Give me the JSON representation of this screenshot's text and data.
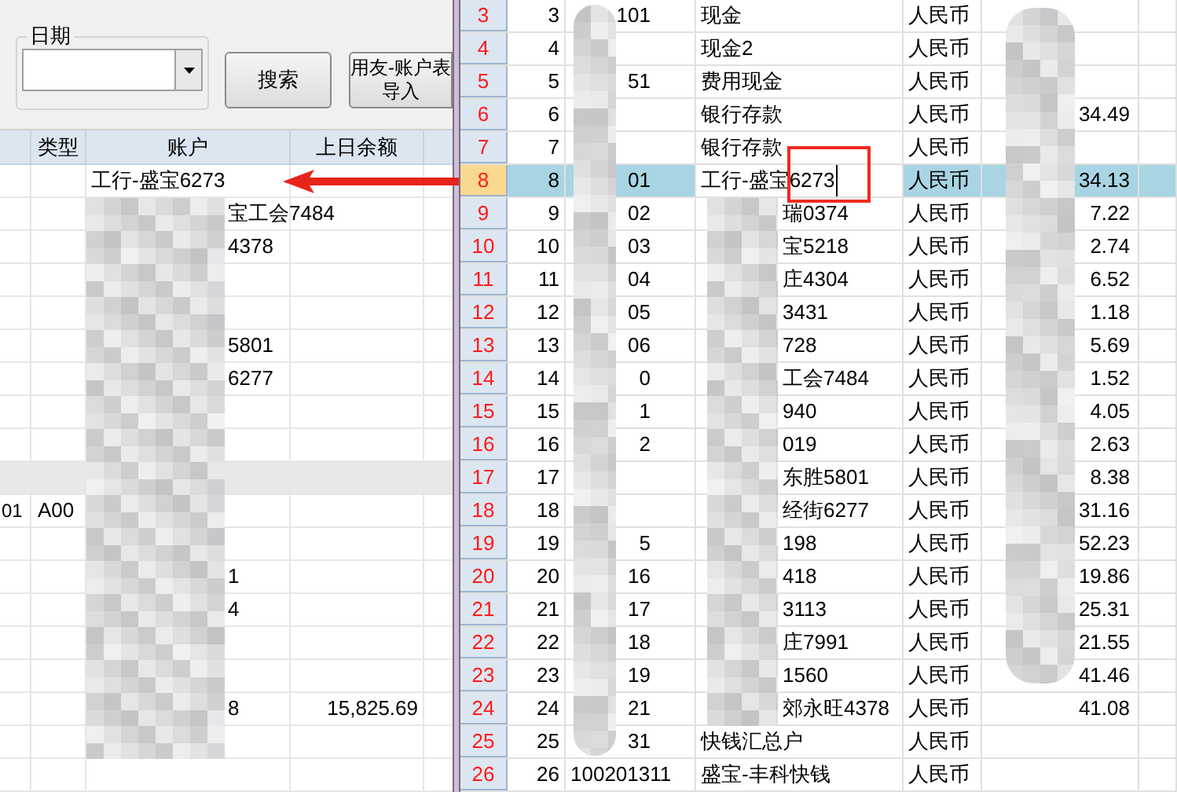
{
  "toolbar": {
    "date_group": {
      "label": "日期"
    },
    "buttons": [
      {
        "label": "搜索"
      },
      {
        "label": "用友-账户表导入"
      }
    ]
  },
  "left_table": {
    "columns": [
      {
        "label": "类型"
      },
      {
        "label": "账户"
      },
      {
        "label": "上日余额"
      }
    ],
    "rows": [
      {
        "account": "工行-盛宝6273",
        "masked": false,
        "selected": false
      },
      {
        "account": "宝工会7484",
        "masked": true,
        "selected": false
      },
      {
        "account": "4378",
        "masked": true,
        "selected": false
      },
      {
        "masked": true,
        "selected": false
      },
      {
        "masked": true,
        "selected": false
      },
      {
        "account": "5801",
        "masked": true,
        "selected": false
      },
      {
        "account": "6277",
        "masked": true,
        "selected": false
      },
      {
        "masked": true,
        "selected": false
      },
      {
        "masked": true,
        "selected": false
      },
      {
        "masked": true,
        "selected": true
      },
      {
        "column_1": "01",
        "type": "A00",
        "masked": true,
        "selected": false
      },
      {
        "masked": true,
        "selected": false
      },
      {
        "account": "1",
        "masked": true,
        "selected": false
      },
      {
        "account": "4",
        "masked": true,
        "selected": false
      },
      {
        "masked": true,
        "selected": false
      },
      {
        "masked": true,
        "selected": false
      },
      {
        "account": "8",
        "balance": "15,825.69",
        "masked": true,
        "selected": false
      },
      {
        "masked": true,
        "selected": false
      },
      {
        "masked": false,
        "selected": false
      }
    ]
  },
  "sheet": {
    "rows": [
      {
        "row_header": "3",
        "seq": "3",
        "code": "101",
        "name": "现金",
        "currency": "人民币",
        "masked": false,
        "selected": false
      },
      {
        "row_header": "4",
        "seq": "4",
        "name": "现金2",
        "currency": "人民币",
        "masked": false,
        "selected": false
      },
      {
        "row_header": "5",
        "seq": "5",
        "code": "51",
        "name": "费用现金",
        "currency": "人民币",
        "masked": false,
        "selected": false
      },
      {
        "row_header": "6",
        "seq": "6",
        "name": "银行存款",
        "currency": "人民币",
        "amount": "34.49",
        "masked": false,
        "selected": false
      },
      {
        "row_header": "7",
        "seq": "7",
        "name": "银行存款",
        "currency": "人民币",
        "masked": false,
        "selected": false
      },
      {
        "row_header": "8",
        "seq": "8",
        "code": "01",
        "name": "工行-盛宝6273",
        "currency": "人民币",
        "amount": "34.13",
        "masked": false,
        "selected": true
      },
      {
        "row_header": "9",
        "seq": "9",
        "code": "02",
        "name": "瑞0374",
        "currency": "人民币",
        "amount": "7.22",
        "masked": true,
        "selected": false
      },
      {
        "row_header": "10",
        "seq": "10",
        "code": "03",
        "name": "宝5218",
        "currency": "人民币",
        "amount": "2.74",
        "masked": true,
        "selected": false
      },
      {
        "row_header": "11",
        "seq": "11",
        "code": "04",
        "name": "庄4304",
        "currency": "人民币",
        "amount": "6.52",
        "masked": true,
        "selected": false
      },
      {
        "row_header": "12",
        "seq": "12",
        "code": "05",
        "name": "3431",
        "currency": "人民币",
        "amount": "1.18",
        "masked": true,
        "selected": false
      },
      {
        "row_header": "13",
        "seq": "13",
        "code": "06",
        "name": "728",
        "currency": "人民币",
        "amount": "5.69",
        "masked": true,
        "selected": false
      },
      {
        "row_header": "14",
        "seq": "14",
        "code": "0",
        "name": "工会7484",
        "currency": "人民币",
        "amount": "1.52",
        "masked": true,
        "selected": false
      },
      {
        "row_header": "15",
        "seq": "15",
        "code": "1",
        "name": "940",
        "currency": "人民币",
        "amount": "4.05",
        "masked": true,
        "selected": false
      },
      {
        "row_header": "16",
        "seq": "16",
        "code": "2",
        "name": "019",
        "currency": "人民币",
        "amount": "2.63",
        "masked": true,
        "selected": false
      },
      {
        "row_header": "17",
        "seq": "17",
        "name": "东胜5801",
        "currency": "人民币",
        "amount": "8.38",
        "masked": true,
        "selected": false
      },
      {
        "row_header": "18",
        "seq": "18",
        "name": "经街6277",
        "currency": "人民币",
        "amount": "31.16",
        "masked": true,
        "selected": false
      },
      {
        "row_header": "19",
        "seq": "19",
        "code": "5",
        "name": "198",
        "currency": "人民币",
        "amount": "52.23",
        "masked": true,
        "selected": false
      },
      {
        "row_header": "20",
        "seq": "20",
        "code": "16",
        "name": "418",
        "currency": "人民币",
        "amount": "19.86",
        "masked": true,
        "selected": false
      },
      {
        "row_header": "21",
        "seq": "21",
        "code": "17",
        "name": "3113",
        "currency": "人民币",
        "amount": "25.31",
        "masked": true,
        "selected": false
      },
      {
        "row_header": "22",
        "seq": "22",
        "code": "18",
        "name": "庄7991",
        "currency": "人民币",
        "amount": "21.55",
        "masked": true,
        "selected": false
      },
      {
        "row_header": "23",
        "seq": "23",
        "code": "19",
        "name": "1560",
        "currency": "人民币",
        "amount": "41.46",
        "masked": true,
        "selected": false
      },
      {
        "row_header": "24",
        "seq": "24",
        "code": "21",
        "name": "郊永旺4378",
        "currency": "人民币",
        "amount": "41.08",
        "masked": true,
        "selected": false
      },
      {
        "row_header": "25",
        "seq": "25",
        "code": "31",
        "name": "快钱汇总户",
        "currency": "人民币",
        "masked": false,
        "selected": false
      },
      {
        "row_header": "26",
        "seq": "26",
        "code": "100201311",
        "name": "盛宝-丰科快钱",
        "currency": "人民币",
        "masked": false,
        "selected": false
      }
    ]
  }
}
